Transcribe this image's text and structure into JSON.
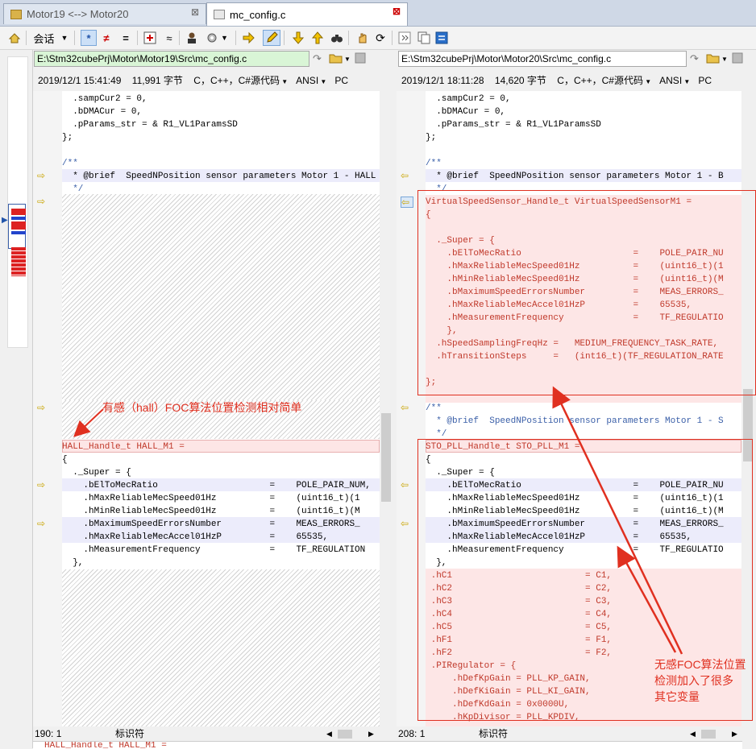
{
  "tabs": [
    {
      "label": "Motor19 <--> Motor20",
      "close": "⊠"
    },
    {
      "label": "mc_config.c",
      "close": "⊠"
    }
  ],
  "toolbar": {
    "session_label": "会话",
    "buttons": [
      "home-icon",
      "star-icon",
      "not-equal-icon",
      "equal-icon",
      "diff-icon",
      "approx-icon",
      "person-icon",
      "gear-icon",
      "next-icon",
      "edit-icon",
      "down-arrow-icon",
      "up-arrow-icon",
      "binoculars-icon",
      "hand-icon",
      "refresh-icon",
      "expand-icon",
      "copy-icon",
      "swap-icon"
    ]
  },
  "left": {
    "path": "E:\\Stm32cubePrj\\Motor\\Motor19\\Src\\mc_config.c",
    "date": "2019/12/1 15:41:49",
    "size": "11,991 字节",
    "lang": "C，C++，C#源代码",
    "encoding": "ANSI",
    "eol": "PC",
    "status_pos": "190: 1",
    "status_mode": "标识符"
  },
  "right": {
    "path": "E:\\Stm32cubePrj\\Motor\\Motor20\\Src\\mc_config.c",
    "date": "2019/12/1 18:11:28",
    "size": "14,620 字节",
    "lang": "C，C++，C#源代码",
    "encoding": "ANSI",
    "eol": "PC",
    "status_pos": "208: 1",
    "status_mode": "标识符"
  },
  "left_code": {
    "l1": "  .sampCur2 = 0,",
    "l2": "  .bDMACur = 0,",
    "l3": "  .pParams_str = & R1_VL1ParamsSD",
    "l4": "};",
    "l5": "/**",
    "l6": "  * @brief  SpeedNPosition sensor parameters Motor 1 - HALL",
    "l7": "  */",
    "h1": "HALL_Handle_t HALL_M1 =",
    "h2": "{",
    "h3": "  ._Super = {",
    "h4": "    .bElToMecRatio                     =    POLE_PAIR_NUM,",
    "h5": "    .hMaxReliableMecSpeed01Hz          =    (uint16_t)(1",
    "h6": "    .hMinReliableMecSpeed01Hz          =    (uint16_t)(M",
    "h7": "    .bMaximumSpeedErrorsNumber         =    MEAS_ERRORS_",
    "h8": "    .hMaxReliableMecAccel01HzP         =    65535,",
    "h9": "    .hMeasurementFrequency             =    TF_REGULATION",
    "h10": "  },"
  },
  "right_code": {
    "l1": "  .sampCur2 = 0,",
    "l2": "  .bDMACur = 0,",
    "l3": "  .pParams_str = & R1_VL1ParamsSD",
    "l4": "};",
    "l5": "/**",
    "l6": "  * @brief  SpeedNPosition sensor parameters Motor 1 - B",
    "l7": "  */",
    "v1": "VirtualSpeedSensor_Handle_t VirtualSpeedSensorM1 =",
    "v2": "{",
    "v3": "  ._Super = {",
    "v4": "    .bElToMecRatio                     =    POLE_PAIR_NU",
    "v5": "    .hMaxReliableMecSpeed01Hz          =    (uint16_t)(1",
    "v6": "    .hMinReliableMecSpeed01Hz          =    (uint16_t)(M",
    "v7": "    .bMaximumSpeedErrorsNumber         =    MEAS_ERRORS_",
    "v8": "    .hMaxReliableMecAccel01HzP         =    65535,",
    "v9": "    .hMeasurementFrequency             =    TF_REGULATIO",
    "v10": "    },",
    "v11": "  .hSpeedSamplingFreqHz =   MEDIUM_FREQUENCY_TASK_RATE,",
    "v12": "  .hTransitionSteps     =   (int16_t)(TF_REGULATION_RATE",
    "v13": "};",
    "c1": "/**",
    "c2": "  * @brief  SpeedNPosition sensor parameters Motor 1 - S",
    "c3": "  */",
    "s1": "STO_PLL_Handle_t STO_PLL_M1 =",
    "s2": "{",
    "s3": "  ._Super = {",
    "s4": "    .bElToMecRatio                     =    POLE_PAIR_NU",
    "s5": "    .hMaxReliableMecSpeed01Hz          =    (uint16_t)(1",
    "s6": "    .hMinReliableMecSpeed01Hz          =    (uint16_t)(M",
    "s7": "    .bMaximumSpeedErrorsNumber         =    MEAS_ERRORS_",
    "s8": "    .hMaxReliableMecAccel01HzP         =    65535,",
    "s9": "    .hMeasurementFrequency             =    TF_REGULATIO",
    "s10": "  },",
    "s11": " .hC1                         = C1,",
    "s12": " .hC2                         = C2,",
    "s13": " .hC3                         = C3,",
    "s14": " .hC4                         = C4,",
    "s15": " .hC5                         = C5,",
    "s16": " .hF1                         = F1,",
    "s17": " .hF2                         = F2,",
    "s18": " .PIRegulator = {",
    "s19": "     .hDefKpGain = PLL_KP_GAIN,",
    "s20": "     .hDefKiGain = PLL_KI_GAIN,",
    "s21": "     .hDefKdGain = 0x0000U,",
    "s22": "     .hKpDivisor = PLL_KPDIV,"
  },
  "bottom_line": "HALL_Handle_t HALL_M1 =",
  "annotations": {
    "left_note": "有感（hall）FOC算法位置检测相对简单",
    "right_note_1": "无感FOC算法位置",
    "right_note_2": "检测加入了很多",
    "right_note_3": "其它变量"
  },
  "colors": {
    "diff_bg": "#fde6e6",
    "diff_text": "#c0392b",
    "blue_bg": "#ececfb",
    "annotation": "#e03020"
  }
}
